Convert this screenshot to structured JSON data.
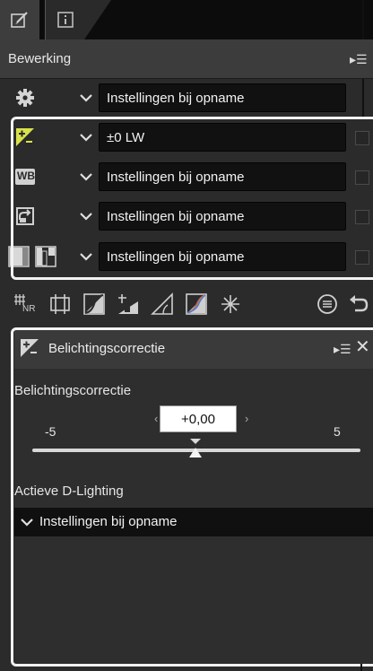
{
  "tabs": [
    {
      "icon": "edit-tab-icon"
    },
    {
      "icon": "info-tab-icon"
    }
  ],
  "edit_panel": {
    "title": "Bewerking",
    "menu_glyph": "▸☰",
    "rows": [
      {
        "icon": "gear-icon",
        "value": "Instellingen bij opname"
      },
      {
        "icon": "exposure-compensation-icon",
        "value": "±0 LW"
      },
      {
        "icon": "white-balance-icon",
        "value": "Instellingen bij opname",
        "icon_text": "WB"
      },
      {
        "icon": "picture-control-icon",
        "value": "Instellingen bij opname"
      },
      {
        "icon": "tone-levels-icon",
        "value": "Instellingen bij opname"
      }
    ]
  },
  "toolbar": {
    "tools": [
      "noise-reduction-icon",
      "crop-icon",
      "tone-curve-icon",
      "d-lighting-icon",
      "straighten-icon",
      "color-balance-icon",
      "retouch-brush-icon",
      "restore-icon",
      "undo-icon"
    ],
    "nr_text": "NR"
  },
  "detail_panel": {
    "title": "Belichtingscorrectie",
    "menu_glyph": "▸☰",
    "close_glyph": "✕",
    "section_exposure": "Belichtingscorrectie",
    "value": "+0,00",
    "prev_arrow": "‹",
    "next_arrow": "›",
    "slider_min": "-5",
    "slider_max": "5",
    "section_dlighting": "Actieve D-Lighting",
    "dlighting_value": "Instellingen bij opname"
  },
  "colors": {
    "panel_bg": "#2b2b2b",
    "field_bg": "#111111",
    "highlight": "#f2f2f2"
  }
}
